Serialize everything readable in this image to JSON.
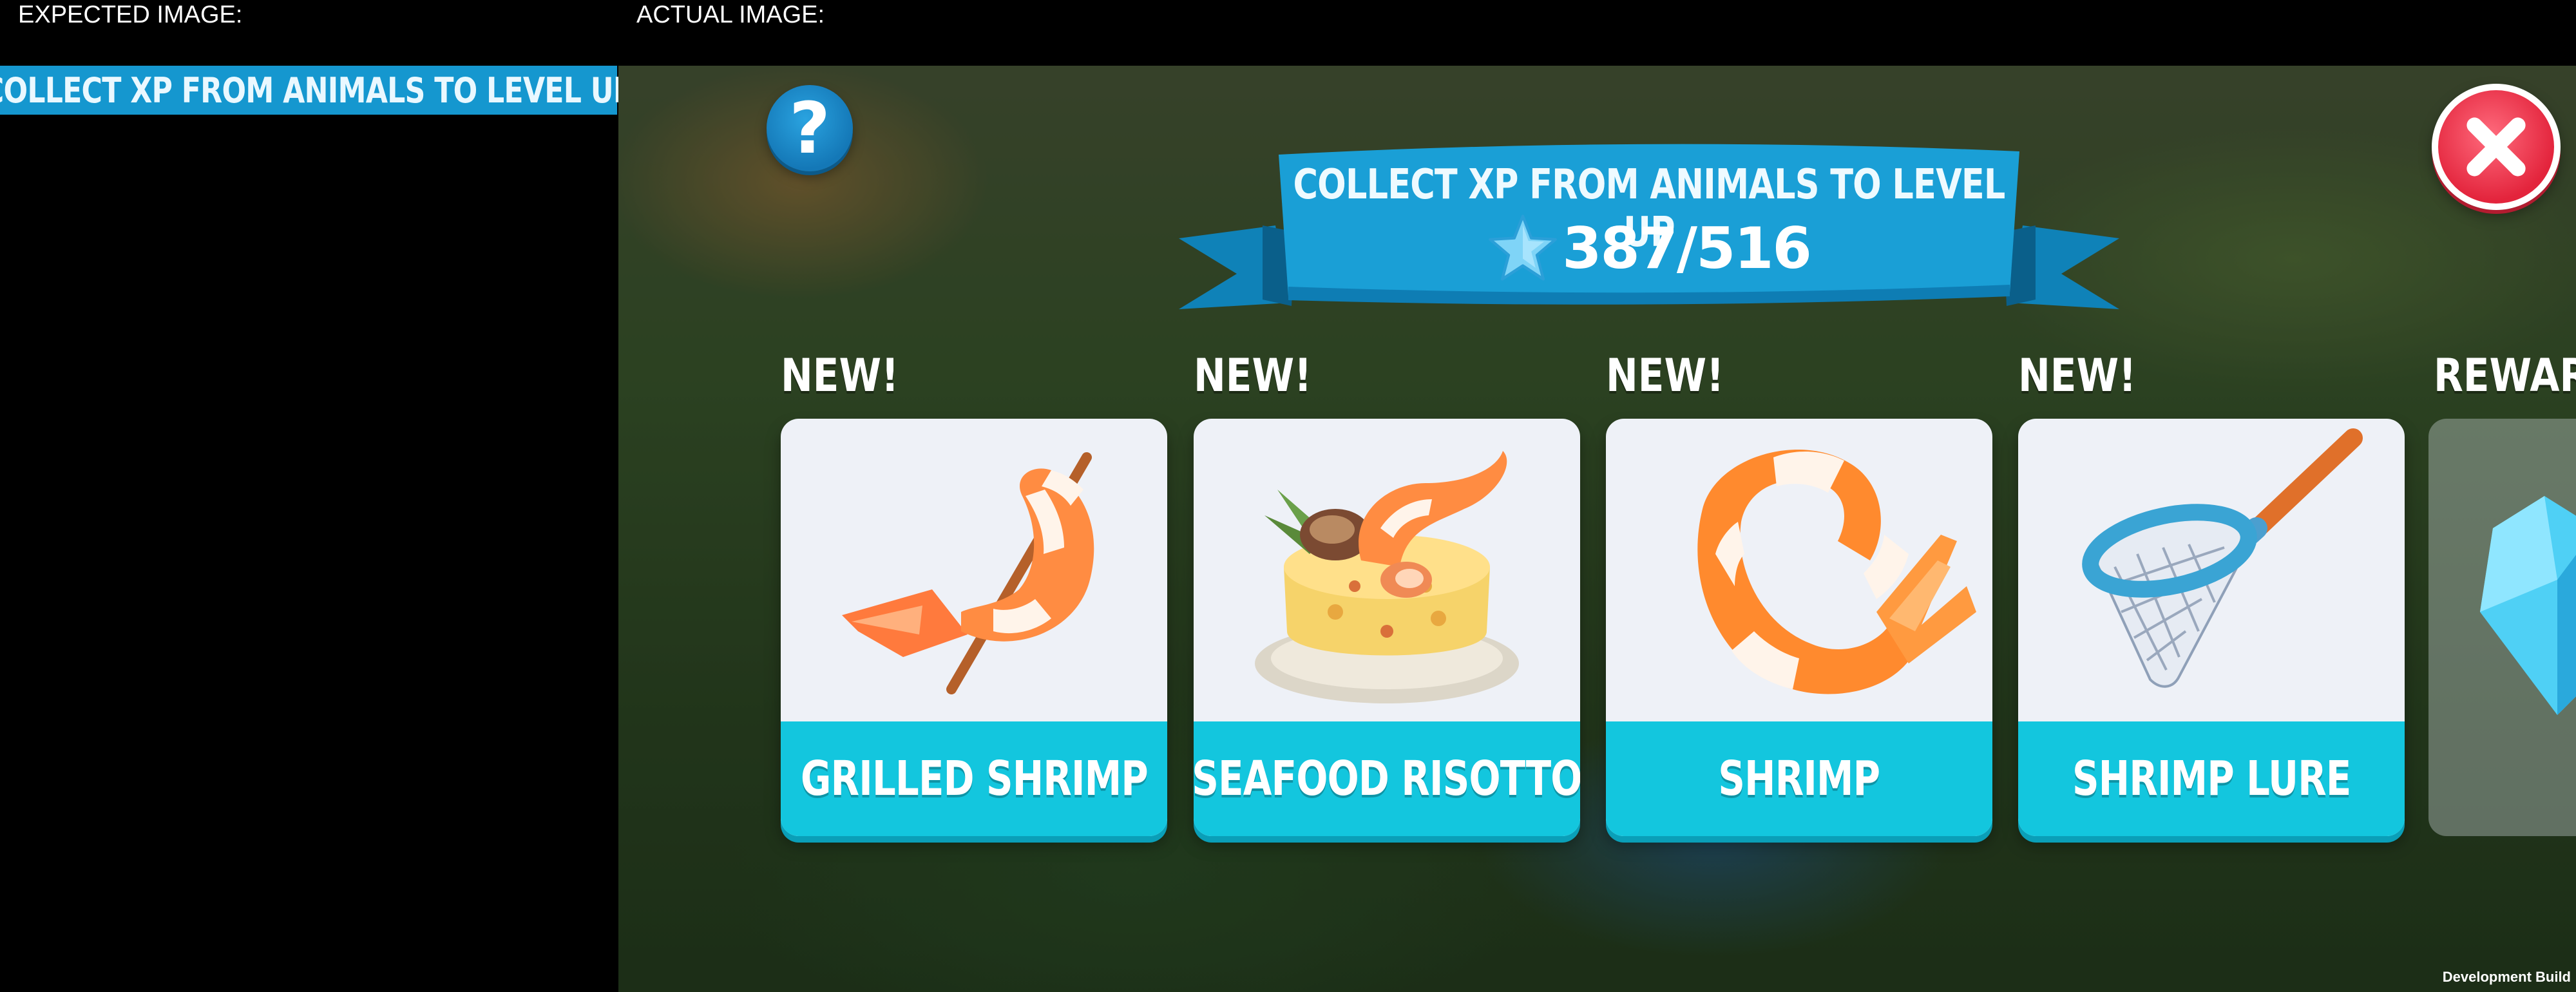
{
  "header": {
    "expected_label": "EXPECTED IMAGE:",
    "actual_label": "ACTUAL IMAGE:"
  },
  "expected_crop": {
    "text": "COLLECT XP FROM ANIMALS TO LEVEL UP"
  },
  "banner": {
    "title": "COLLECT XP FROM ANIMALS TO LEVEL UP",
    "xp": "387/516"
  },
  "cards": [
    {
      "badge": "NEW!",
      "name": "GRILLED SHRIMP",
      "icon": "grilled-shrimp-icon"
    },
    {
      "badge": "NEW!",
      "name": "SEAFOOD RISOTTO",
      "icon": "seafood-risotto-icon"
    },
    {
      "badge": "NEW!",
      "name": "SHRIMP",
      "icon": "shrimp-icon"
    },
    {
      "badge": "NEW!",
      "name": "SHRIMP LURE",
      "icon": "shrimp-lure-icon"
    }
  ],
  "reward": {
    "badge": "REWAR",
    "icon": "gem-icon"
  },
  "footer": {
    "build_label": "Development Build"
  },
  "colors": {
    "banner_blue": "#1597cf",
    "card_footer": "#13c6de",
    "close_red": "#e3243c",
    "help_blue": "#1478b7"
  }
}
